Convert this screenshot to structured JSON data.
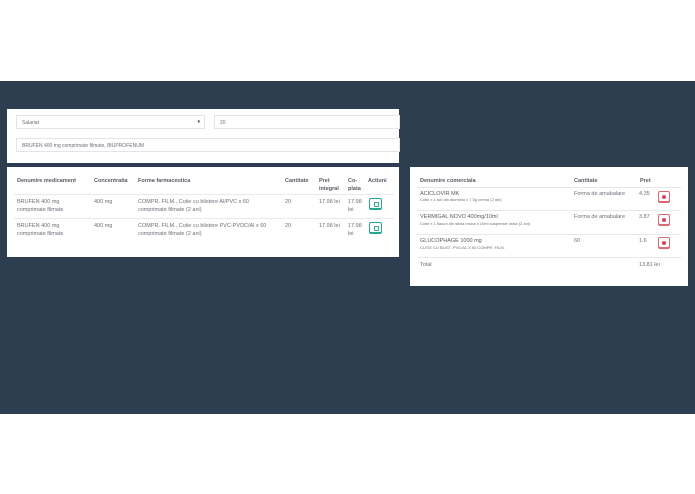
{
  "search": {
    "selected_category": "Salariat",
    "quantity_value": "20",
    "result_value": "BRUFEN 400 mg comprimate filmate, IBUPROFENUM"
  },
  "meds_table": {
    "headers": {
      "name": "Denumire medicament",
      "concentration": "Concentratia",
      "form": "Forma farmaceutica",
      "quantity": "Cantitate",
      "price_1": "Pret",
      "price_2": "integral",
      "copay_1": "Co-",
      "copay_2": "plata",
      "actions": "Actiuni"
    },
    "rows": [
      {
        "name_1": "BRUFEN 400 mg",
        "name_2": "comprimate filmate",
        "concentration": "400 mg",
        "form_1": "COMPR. FILM., Cutie cu blistere Al/PVC x 60",
        "form_2": "comprimate filmate (2 ani)",
        "quantity": "20",
        "price": "17.98 lei",
        "copay_1": "17.98",
        "copay_2": "lei"
      },
      {
        "name_1": "BRUFEN 400 mg",
        "name_2": "comprimate filmate",
        "concentration": "400 mg",
        "form_1": "COMPR. FILM., Cutie cu blistere PVC-PVDC/Al x 60",
        "form_2": "comprimate filmate (2 ani)",
        "quantity": "20",
        "price": "17.98 lei",
        "copay_1": "17.98",
        "copay_2": "lei"
      }
    ]
  },
  "cart": {
    "headers": {
      "name": "Denumire comerciala",
      "quantity": "Cantitate",
      "price": "Pret"
    },
    "items": [
      {
        "name": "ACICLOVIR MK",
        "desc": "Cutie x 1 tub din aluminiu x 7,5g crema (2 ani)",
        "quantity": "Forma de amabalare",
        "price": "4.35"
      },
      {
        "name": "VERMIGAL NOVO 400mg/10ml",
        "desc": "Cutie x 1 flacon din sticla bruna x 10ml suspensie orala (2 ani)",
        "quantity": "Forma de amabalare",
        "price": "3.87"
      },
      {
        "name": "GLUCOPHAGE 1000 mg",
        "desc": "CUTIE CU BLIST. PVC/AL X 60 COMPR. FILM.",
        "quantity": "60",
        "price": "1.6"
      }
    ],
    "total_label": "Total",
    "total_value": "13.81 lei"
  }
}
